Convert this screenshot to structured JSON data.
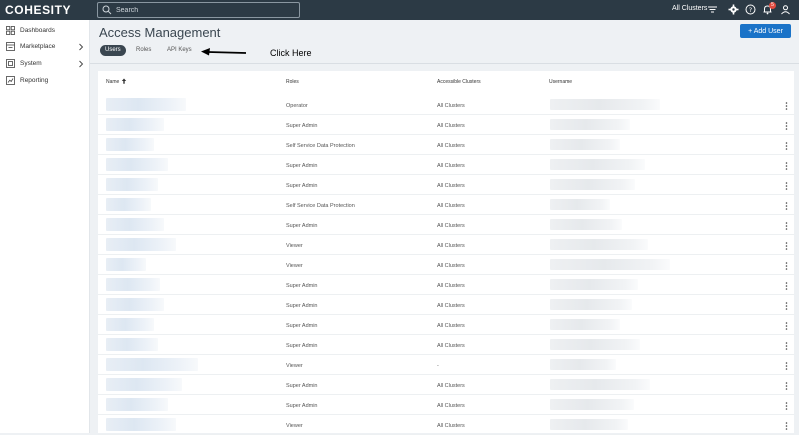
{
  "app": {
    "logo_text": "COHESITY"
  },
  "topbar": {
    "search_placeholder": "Search",
    "cluster_label": "All Clusters",
    "notification_count": "5",
    "icons": [
      "search-icon",
      "filter-icon",
      "gear-icon",
      "help-icon",
      "bell-icon",
      "user-icon"
    ]
  },
  "sidebar": {
    "items": [
      {
        "label": "Dashboards",
        "icon": "dashboard-icon"
      },
      {
        "label": "Marketplace",
        "icon": "marketplace-icon",
        "expandable": true
      },
      {
        "label": "System",
        "icon": "system-icon",
        "expandable": true
      },
      {
        "label": "Reporting",
        "icon": "reporting-icon"
      }
    ]
  },
  "page": {
    "title": "Access Management",
    "add_user_label": "+ Add User",
    "tabs": [
      {
        "label": "Users",
        "active": true
      },
      {
        "label": "Roles",
        "active": false
      },
      {
        "label": "API Keys",
        "active": false
      }
    ],
    "annotation": "Click Here"
  },
  "table": {
    "columns": [
      "Name",
      "Roles",
      "Accessible Clusters",
      "Username"
    ],
    "rows": [
      {
        "role": "Operator",
        "clusters": "All Clusters"
      },
      {
        "role": "Super Admin",
        "clusters": "All Clusters"
      },
      {
        "role": "Self Service Data Protection",
        "clusters": "All Clusters"
      },
      {
        "role": "Super Admin",
        "clusters": "All Clusters"
      },
      {
        "role": "Super Admin",
        "clusters": "All Clusters"
      },
      {
        "role": "Self Service Data Protection",
        "clusters": "All Clusters"
      },
      {
        "role": "Super Admin",
        "clusters": "All Clusters"
      },
      {
        "role": "Viewer",
        "clusters": "All Clusters"
      },
      {
        "role": "Viewer",
        "clusters": "All Clusters"
      },
      {
        "role": "Super Admin",
        "clusters": "All Clusters"
      },
      {
        "role": "Super Admin",
        "clusters": "All Clusters"
      },
      {
        "role": "Super Admin",
        "clusters": "All Clusters"
      },
      {
        "role": "Super Admin",
        "clusters": "All Clusters"
      },
      {
        "role": "Viewer",
        "clusters": "-"
      },
      {
        "role": "Super Admin",
        "clusters": "All Clusters"
      },
      {
        "role": "Super Admin",
        "clusters": "All Clusters"
      },
      {
        "role": "Viewer",
        "clusters": "All Clusters"
      }
    ]
  },
  "colors": {
    "topbar": "#2c3a45",
    "accent": "#1a73c8",
    "badge": "#e04a3f",
    "tab_active": "#3a4650"
  }
}
